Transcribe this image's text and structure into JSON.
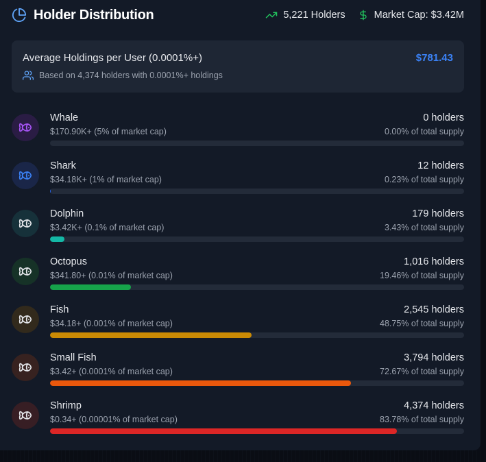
{
  "header": {
    "title": "Holder Distribution",
    "title_icon": "pie-chart-icon",
    "holders": "5,221 Holders",
    "holders_icon": "trending-up-icon",
    "market_cap": "Market Cap: $3.42M",
    "market_cap_icon": "dollar-icon"
  },
  "average": {
    "title": "Average Holdings per User (0.0001%+)",
    "value": "$781.43",
    "subtitle": "Based on 4,374 holders with 0.0001%+ holdings",
    "subtitle_icon": "users-icon"
  },
  "tiers": [
    {
      "name": "Whale",
      "range": "$170.90K+ (5% of market cap)",
      "holders": "0 holders",
      "supply": "0.00% of total supply",
      "percent": 0.0,
      "color": "#9333ea",
      "avatar_bg": "#2a1c44",
      "icon": "fish-icon"
    },
    {
      "name": "Shark",
      "range": "$34.18K+ (1% of market cap)",
      "holders": "12 holders",
      "supply": "0.23% of total supply",
      "percent": 0.23,
      "color": "#2563eb",
      "avatar_bg": "#1a2648",
      "icon": "fish-icon"
    },
    {
      "name": "Dolphin",
      "range": "$3.42K+ (0.1% of market cap)",
      "holders": "179 holders",
      "supply": "3.43% of total supply",
      "percent": 3.43,
      "color": "#14b8a6",
      "avatar_bg": "#16313a",
      "icon": "fish-icon"
    },
    {
      "name": "Octopus",
      "range": "$341.80+ (0.01% of market cap)",
      "holders": "1,016 holders",
      "supply": "19.46% of total supply",
      "percent": 19.46,
      "color": "#16a34a",
      "avatar_bg": "#163227",
      "icon": "fish-icon"
    },
    {
      "name": "Fish",
      "range": "$34.18+ (0.001% of market cap)",
      "holders": "2,545 holders",
      "supply": "48.75% of total supply",
      "percent": 48.75,
      "color": "#ca8a04",
      "avatar_bg": "#322a1c",
      "icon": "fish-icon"
    },
    {
      "name": "Small Fish",
      "range": "$3.42+ (0.0001% of market cap)",
      "holders": "3,794 holders",
      "supply": "72.67% of total supply",
      "percent": 72.67,
      "color": "#ea580c",
      "avatar_bg": "#372220",
      "icon": "fish-icon"
    },
    {
      "name": "Shrimp",
      "range": "$0.34+ (0.00001% of market cap)",
      "holders": "4,374 holders",
      "supply": "83.78% of total supply",
      "percent": 83.78,
      "color": "#dc2626",
      "avatar_bg": "#371e24",
      "icon": "fish-icon"
    }
  ]
}
